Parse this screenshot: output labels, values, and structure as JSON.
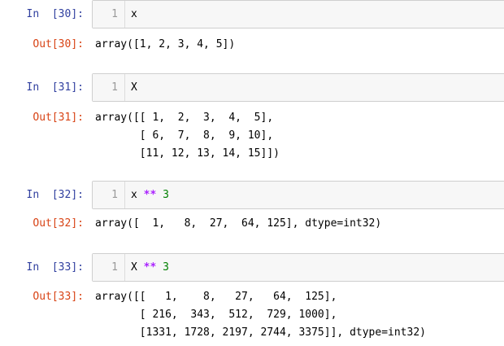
{
  "cells": [
    {
      "in_prompt": "In  [30]:",
      "line_number": "1",
      "code_plain": "x",
      "out_prompt": "Out[30]:",
      "output": "array([1, 2, 3, 4, 5])"
    },
    {
      "in_prompt": "In  [31]:",
      "line_number": "1",
      "code_plain": "X",
      "out_prompt": "Out[31]:",
      "output": "array([[ 1,  2,  3,  4,  5],\n       [ 6,  7,  8,  9, 10],\n       [11, 12, 13, 14, 15]])"
    },
    {
      "in_prompt": "In  [32]:",
      "line_number": "1",
      "code_var": "x",
      "code_op": "**",
      "code_num": "3",
      "out_prompt": "Out[32]:",
      "output": "array([  1,   8,  27,  64, 125], dtype=int32)"
    },
    {
      "in_prompt": "In  [33]:",
      "line_number": "1",
      "code_var": "X",
      "code_op": "**",
      "code_num": "3",
      "out_prompt": "Out[33]:",
      "output": "array([[   1,    8,   27,   64,  125],\n       [ 216,  343,  512,  729, 1000],\n       [1331, 1728, 2197, 2744, 3375]], dtype=int32)"
    }
  ],
  "colors": {
    "in_prompt": "#303f9f",
    "out_prompt": "#d84315",
    "operator": "#aa22ff",
    "number": "#008000",
    "input_bg": "#f7f7f7",
    "input_border": "#cfcfcf"
  }
}
